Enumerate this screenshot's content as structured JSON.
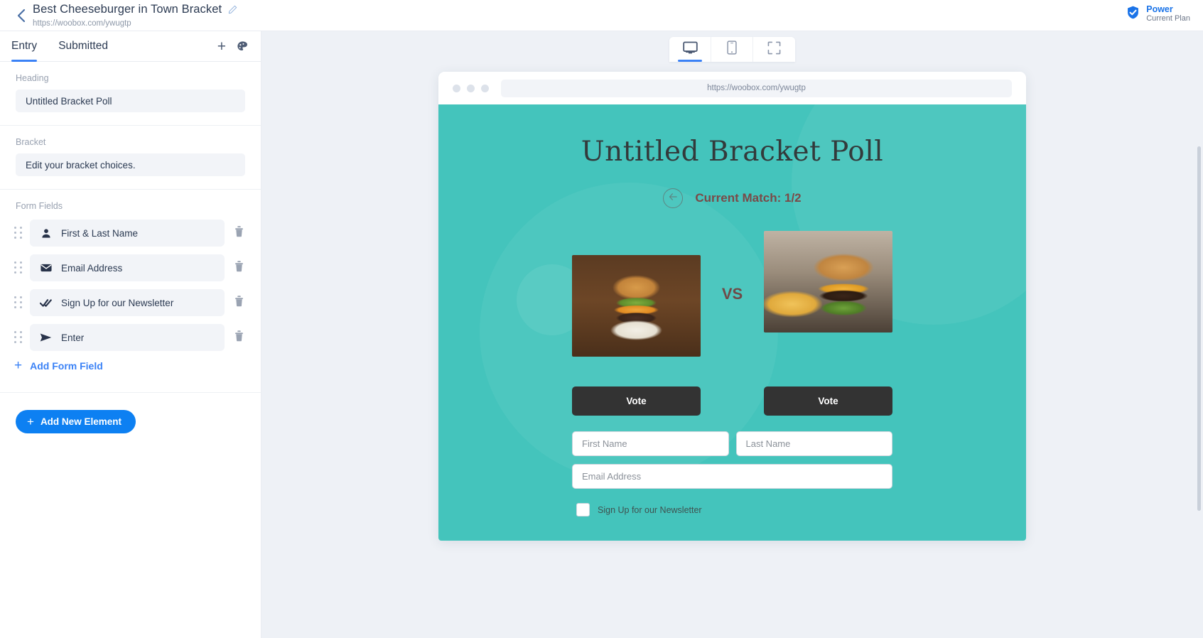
{
  "topbar": {
    "back_icon": "chevron-left-icon",
    "campaign_title": "Best Cheeseburger in Town Bracket",
    "edit_icon": "pencil-icon",
    "campaign_url": "https://woobox.com/ywugtp",
    "plan": {
      "badge_icon": "verified-check-badge-icon",
      "name": "Power",
      "subtitle": "Current Plan"
    }
  },
  "sidebar": {
    "tabs": [
      {
        "label": "Entry",
        "active": true
      },
      {
        "label": "Submitted",
        "active": false
      }
    ],
    "actions": {
      "add_icon": "plus-icon",
      "add_label": "+",
      "theme_icon": "palette-icon"
    },
    "heading_section": {
      "label": "Heading",
      "value": "Untitled Bracket Poll"
    },
    "bracket_section": {
      "label": "Bracket",
      "value": "Edit your bracket choices."
    },
    "form_fields_section": {
      "label": "Form Fields",
      "fields": [
        {
          "icon": "person-icon",
          "label": "First & Last Name",
          "delete_icon": "trash-icon"
        },
        {
          "icon": "envelope-icon",
          "label": "Email Address",
          "delete_icon": "trash-icon"
        },
        {
          "icon": "double-check-icon",
          "label": "Sign Up for our Newsletter",
          "delete_icon": "trash-icon"
        },
        {
          "icon": "paper-plane-icon",
          "label": "Enter",
          "delete_icon": "trash-icon"
        }
      ],
      "add_field_label": "Add Form Field",
      "add_field_icon": "plus-icon"
    },
    "add_new_element_label": "Add New Element",
    "add_new_element_icon": "plus-icon"
  },
  "preview": {
    "device_tabs": [
      {
        "icon": "desktop-monitor-icon",
        "active": true
      },
      {
        "icon": "mobile-phone-icon",
        "active": false
      },
      {
        "icon": "fullscreen-expand-icon",
        "active": false
      }
    ],
    "browser": {
      "url": "https://woobox.com/ywugtp",
      "dots": 3
    },
    "poll": {
      "background_color": "#44c4bc",
      "title": "Untitled Bracket Poll",
      "back_icon": "arrow-left-icon",
      "match_label": "Current Match: 1/2",
      "vs_label": "VS",
      "contenders": [
        {
          "image": "cheeseburger-on-plate-photo",
          "vote_label": "Vote"
        },
        {
          "image": "cheeseburger-with-fries-photo",
          "vote_label": "Vote"
        }
      ],
      "form": {
        "first_name_placeholder": "First Name",
        "last_name_placeholder": "Last Name",
        "email_placeholder": "Email Address",
        "newsletter_label": "Sign Up for our Newsletter",
        "newsletter_checked": false
      }
    }
  }
}
